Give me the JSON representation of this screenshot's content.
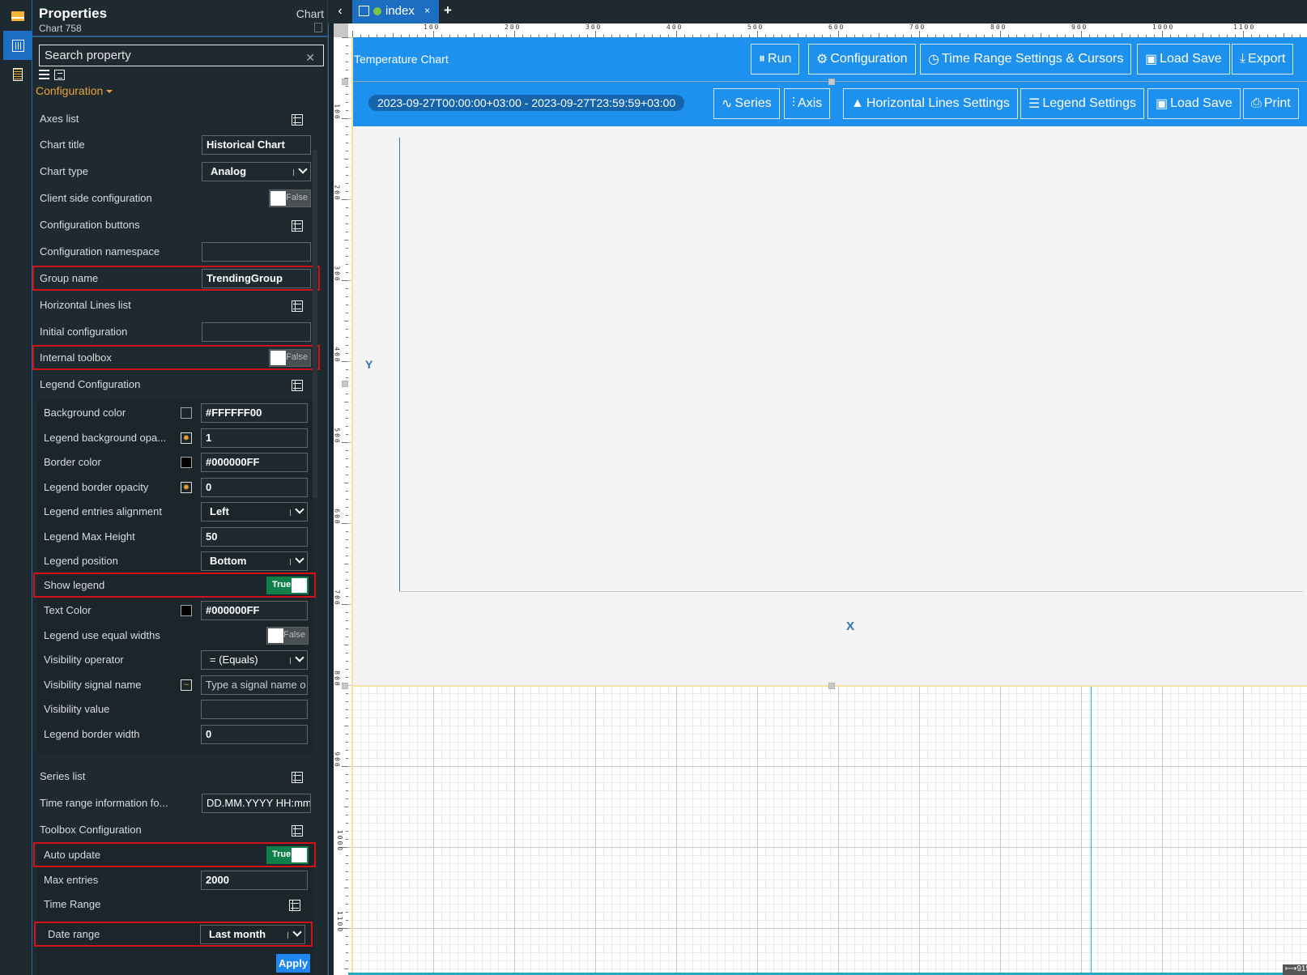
{
  "rail": {
    "items": [
      {
        "name": "toolbox",
        "icon": "toolbox-icon"
      },
      {
        "name": "properties",
        "icon": "properties-icon",
        "active": true
      },
      {
        "name": "document",
        "icon": "document-icon"
      }
    ]
  },
  "panel": {
    "title": "Properties",
    "subtitle": "Chart 758",
    "type": "Chart",
    "search_placeholder": "Search property",
    "section": "Configuration",
    "rows": {
      "axes_list": "Axes list",
      "chart_title": {
        "label": "Chart title",
        "value": "Historical Chart"
      },
      "chart_type": {
        "label": "Chart type",
        "value": "Analog"
      },
      "client_side": {
        "label": "Client side configuration",
        "value": "False"
      },
      "config_buttons": "Configuration buttons",
      "config_namespace": {
        "label": "Configuration namespace",
        "value": ""
      },
      "group_name": {
        "label": "Group name",
        "value": "TrendingGroup"
      },
      "hlines_list": "Horizontal Lines list",
      "initial_config": {
        "label": "Initial configuration",
        "value": ""
      },
      "internal_toolbox": {
        "label": "Internal toolbox",
        "value": "False"
      },
      "legend_config": "Legend Configuration",
      "bg_color": {
        "label": "Background color",
        "value": "#FFFFFF00"
      },
      "legend_bg_opacity": {
        "label": "Legend background opa...",
        "value": "1"
      },
      "border_color": {
        "label": "Border color",
        "value": "#000000FF"
      },
      "legend_border_opacity": {
        "label": "Legend border opacity",
        "value": "0"
      },
      "legend_align": {
        "label": "Legend entries alignment",
        "value": "Left"
      },
      "legend_max_height": {
        "label": "Legend Max Height",
        "value": "50"
      },
      "legend_position": {
        "label": "Legend position",
        "value": "Bottom"
      },
      "show_legend": {
        "label": "Show legend",
        "value": "True"
      },
      "text_color": {
        "label": "Text Color",
        "value": "#000000FF"
      },
      "legend_equal_widths": {
        "label": "Legend use equal widths",
        "value": "False"
      },
      "visibility_operator": {
        "label": "Visibility operator",
        "value": "= (Equals)"
      },
      "visibility_signal": {
        "label": "Visibility signal name",
        "placeholder": "Type a signal name o"
      },
      "visibility_value": {
        "label": "Visibility value",
        "value": ""
      },
      "legend_border_width": {
        "label": "Legend border width",
        "value": "0"
      },
      "series_list": "Series list",
      "time_range_format": {
        "label": "Time range information fo...",
        "value": "DD.MM.YYYY HH:mm"
      },
      "toolbox_config": "Toolbox Configuration",
      "auto_update": {
        "label": "Auto update",
        "value": "True"
      },
      "max_entries": {
        "label": "Max entries",
        "value": "2000"
      },
      "time_range": "Time Range",
      "date_range": {
        "label": "Date range",
        "value": "Last month"
      }
    },
    "apply": "Apply"
  },
  "tabs": {
    "items": [
      {
        "label": "index",
        "close": "×"
      }
    ],
    "add": "+",
    "back": "‹"
  },
  "ruler": {
    "h": [
      "100",
      "200",
      "300",
      "400",
      "500",
      "600",
      "700",
      "800",
      "900",
      "1000",
      "1100"
    ],
    "v": [
      "100",
      "200",
      "300",
      "400",
      "500",
      "600",
      "700",
      "800",
      "900",
      "1000",
      "1100"
    ]
  },
  "widget": {
    "title": "Temperature Chart",
    "time_range": "2023-09-27T00:00:00+03:00 - 2023-09-27T23:59:59+03:00",
    "toolbar1": [
      {
        "label": "Run",
        "icon": "pause-icon",
        "glyph": "⏸"
      },
      {
        "label": "Configuration",
        "icon": "gears-icon",
        "glyph": "⚙"
      },
      {
        "label": "Time Range Settings & Cursors",
        "icon": "clock-icon",
        "glyph": "◷"
      },
      {
        "label": "Load Save",
        "icon": "save-icon",
        "glyph": "▣"
      },
      {
        "label": "Export",
        "icon": "download-icon",
        "glyph": "⤓"
      }
    ],
    "toolbar2": [
      {
        "label": "Series",
        "icon": "series-icon",
        "glyph": "∿"
      },
      {
        "label": "Axis",
        "icon": "axis-icon",
        "glyph": "⫶"
      },
      {
        "label": "Horizontal Lines Settings",
        "icon": "image-icon",
        "glyph": "▲"
      },
      {
        "label": "Legend Settings",
        "icon": "list-icon",
        "glyph": "☰"
      },
      {
        "label": "Load Save",
        "icon": "save-icon",
        "glyph": "▣"
      },
      {
        "label": "Print",
        "icon": "print-icon",
        "glyph": "⎙"
      }
    ],
    "y_label": "Y",
    "x_label": "X"
  },
  "size_badge": "⟼915"
}
